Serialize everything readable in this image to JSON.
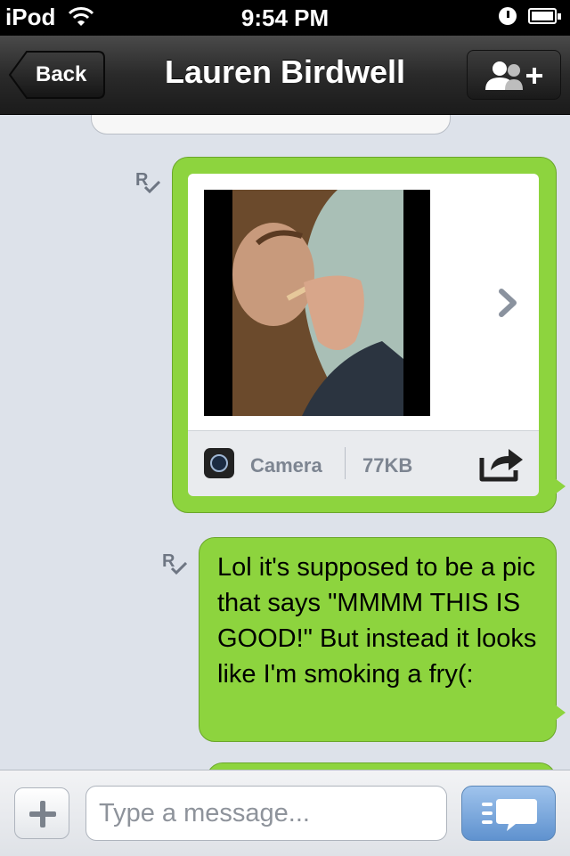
{
  "status_bar": {
    "carrier": "iPod",
    "time": "9:54 PM",
    "icons": [
      "wifi-icon",
      "alarm-icon",
      "battery-icon"
    ]
  },
  "nav": {
    "back_label": "Back",
    "title": "Lauren Birdwell",
    "add_friend_icon": "add-contact-icon"
  },
  "messages": {
    "read_indicator": "R",
    "photo": {
      "source": "Camera",
      "size": "77KB",
      "icons": [
        "camera-icon",
        "chevron-right-icon",
        "share-icon"
      ]
    },
    "text": "Lol it's supposed to be a pic that says \"MMMM THIS IS GOOD!\" But instead it looks like I'm smoking a fry(:"
  },
  "input_bar": {
    "placeholder": "Type a message...",
    "value": "",
    "icons": [
      "plus-icon",
      "send-chat-icon"
    ]
  },
  "colors": {
    "bubble_green": "#8dd43e",
    "nav_dark": "#1b1b1b",
    "send_blue": "#5f92cf",
    "background": "#dde2ea"
  }
}
